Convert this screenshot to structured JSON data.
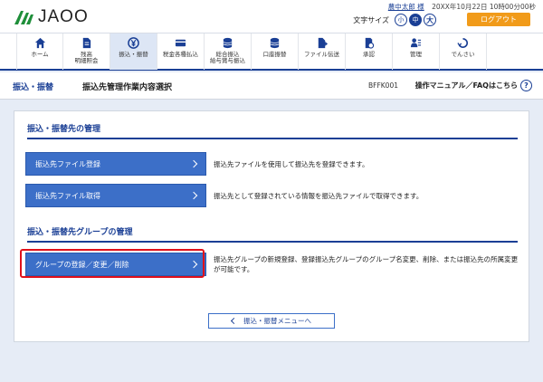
{
  "app": {
    "logo_text": "JAOO"
  },
  "user": {
    "name": "農中太郎 様",
    "datetime": "20XX年10月22日 10時00分00秒"
  },
  "textsize": {
    "label": "文字サイズ",
    "small": "小",
    "medium": "中",
    "large": "大"
  },
  "logout_label": "ログアウト",
  "nav": {
    "items": [
      {
        "label": "ホーム",
        "icon": "home-icon"
      },
      {
        "label": "残高\n明細照会",
        "icon": "document-icon"
      },
      {
        "label": "振込・振替",
        "icon": "yen-coin-icon"
      },
      {
        "label": "税金各種払込",
        "icon": "card-icon"
      },
      {
        "label": "総合振込\n給与賞与振込",
        "icon": "coin-stack-icon"
      },
      {
        "label": "口座振替",
        "icon": "coin-stack-icon"
      },
      {
        "label": "ファイル伝送",
        "icon": "file-transfer-icon"
      },
      {
        "label": "承認",
        "icon": "approval-icon"
      },
      {
        "label": "管理",
        "icon": "admin-icon"
      },
      {
        "label": "でんさい",
        "icon": "densai-icon"
      }
    ]
  },
  "titlebar": {
    "category": "振込・振替",
    "title": "振込先管理作業内容選択",
    "screen_id": "BFFK001",
    "help_label": "操作マニュアル／FAQはこちら",
    "help_icon": "?"
  },
  "sections": [
    {
      "heading": "振込・振替先の管理",
      "buttons": [
        {
          "label": "振込先ファイル登録",
          "description": "振込先ファイルを使用して振込先を登録できます。"
        },
        {
          "label": "振込先ファイル取得",
          "description": "振込先として登録されている情報を振込先ファイルで取得できます。"
        }
      ]
    },
    {
      "heading": "振込・振替先グループの管理",
      "buttons": [
        {
          "label": "グループの登録／変更／削除",
          "description": "振込先グループの新規登録、登録振込先グループのグループ名変更、削除、または振込先の所属変更が可能です。"
        }
      ]
    }
  ],
  "back_button_label": "振込・振替メニューへ",
  "colors": {
    "primary": "#1a3f95",
    "button": "#3c6fc8",
    "logout": "#f19b1a",
    "highlight": "#e0101a"
  }
}
